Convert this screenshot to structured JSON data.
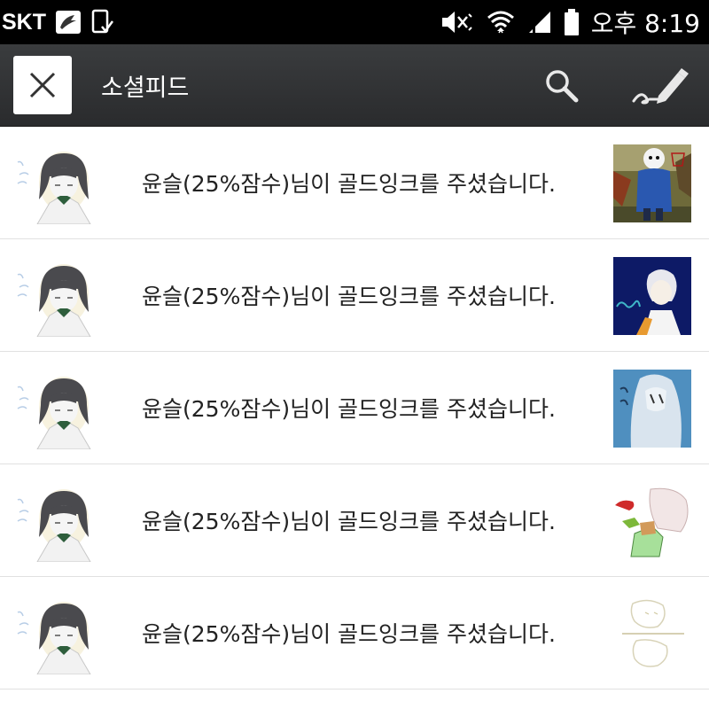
{
  "status_bar": {
    "carrier": "SKT",
    "time": "오후 8:19",
    "icons": [
      "notification-app-icon",
      "screenshot-icon",
      "mute-icon",
      "wifi-icon",
      "signal-icon",
      "battery-icon"
    ]
  },
  "header": {
    "title": "소셜피드",
    "close_icon": "close-icon",
    "search_icon": "search-icon",
    "write_icon": "pen-icon"
  },
  "feed": {
    "items": [
      {
        "text": "윤슬(25%잠수)님이 골드잉크를 주셨습니다."
      },
      {
        "text": "윤슬(25%잠수)님이 골드잉크를 주셨습니다."
      },
      {
        "text": "윤슬(25%잠수)님이 골드잉크를 주셨습니다."
      },
      {
        "text": "윤슬(25%잠수)님이 골드잉크를 주셨습니다."
      },
      {
        "text": "윤슬(25%잠수)님이 골드잉크를 주셨습니다."
      }
    ]
  },
  "colors": {
    "status_bar": "#000000",
    "action_bar": "#2f3133",
    "divider": "#e1e1e1",
    "text": "#222222"
  }
}
